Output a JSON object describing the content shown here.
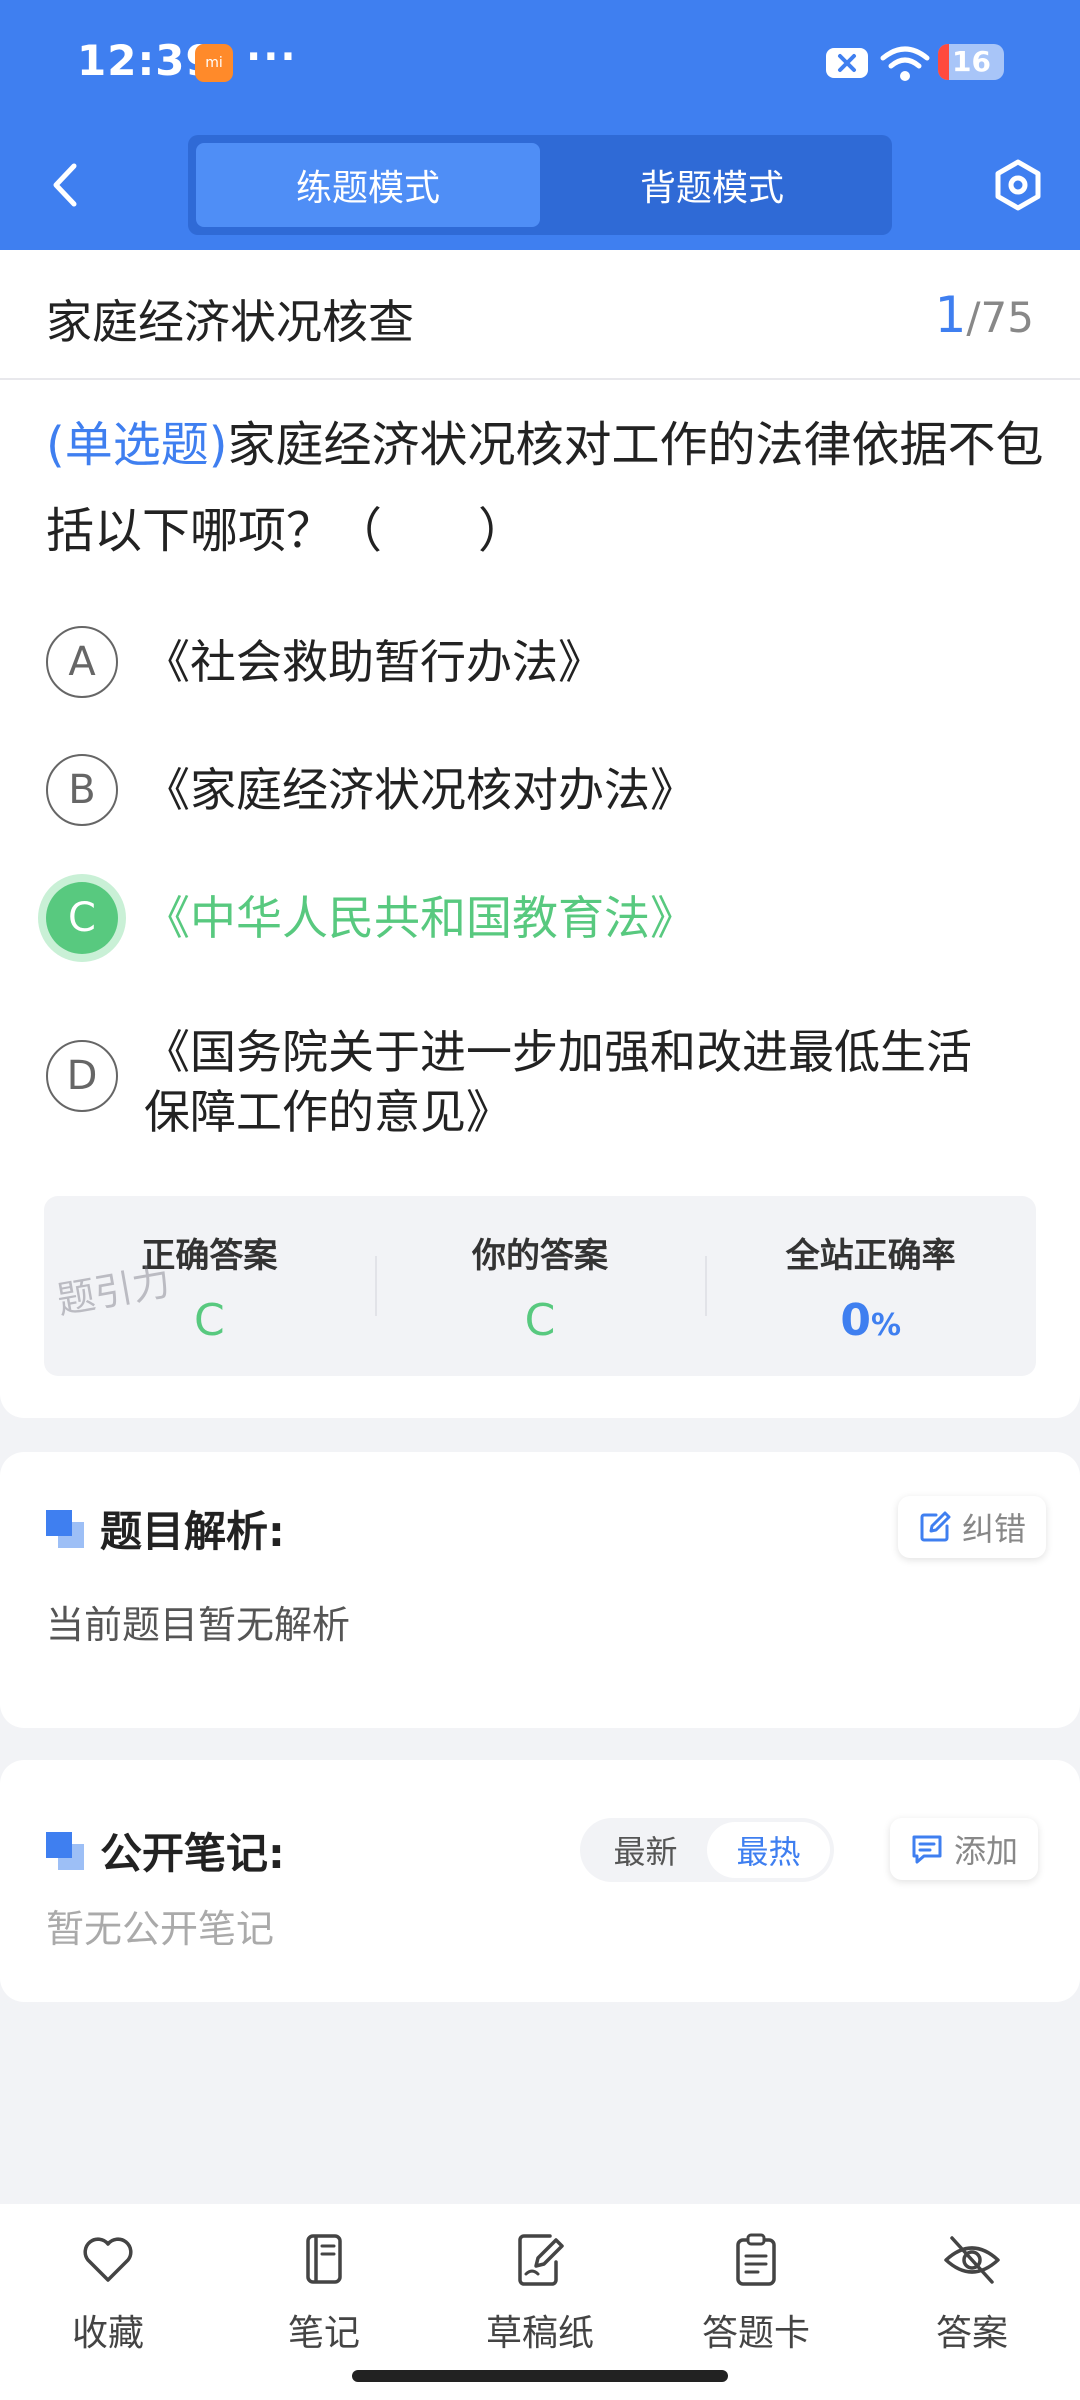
{
  "status_bar": {
    "time": "12:39",
    "app_badge_text": "mi",
    "more_dots": "···",
    "battery_level": "16",
    "battery_fraction": 0.16
  },
  "header": {
    "back_icon": "chevron-left-icon",
    "tabs": [
      {
        "label": "练题模式",
        "active": true
      },
      {
        "label": "背题模式",
        "active": false
      }
    ],
    "settings_icon": "hexagon-gear-icon"
  },
  "question": {
    "chapter_title": "家庭经济状况核查",
    "current_index": "1",
    "total": "/75",
    "type_label": "(单选题)",
    "text": "家庭经济状况核对工作的法律依据不包括以下哪项？（　　）",
    "options": [
      {
        "letter": "A",
        "text": "《社会救助暂行办法》"
      },
      {
        "letter": "B",
        "text": "《家庭经济状况核对办法》"
      },
      {
        "letter": "C",
        "text": "《中华人民共和国教育法》"
      },
      {
        "letter": "D",
        "text": "《国务院关于进一步加强和改进最低生活保障工作的意见》"
      }
    ]
  },
  "answer_panel": {
    "correct_label": "正确答案",
    "correct_value": "C",
    "yours_label": "你的答案",
    "yours_value": "C",
    "rate_label": "全站正确率",
    "rate_value": "0",
    "rate_unit": "%",
    "watermark": "题引力"
  },
  "analysis": {
    "title": "题目解析:",
    "report_label": "纠错",
    "body": "当前题目暂无解析"
  },
  "notes": {
    "title": "公开笔记:",
    "sort_latest": "最新",
    "sort_hot": "最热",
    "add_label": "添加",
    "body": "暂无公开笔记"
  },
  "bottom_bar": [
    {
      "label": "收藏",
      "icon": "heart-icon"
    },
    {
      "label": "笔记",
      "icon": "notebook-icon"
    },
    {
      "label": "草稿纸",
      "icon": "draft-paper-icon"
    },
    {
      "label": "答题卡",
      "icon": "answer-card-icon"
    },
    {
      "label": "答案",
      "icon": "eye-off-icon"
    }
  ],
  "colors": {
    "primary": "#3f7ff0",
    "correct": "#58c97f"
  }
}
